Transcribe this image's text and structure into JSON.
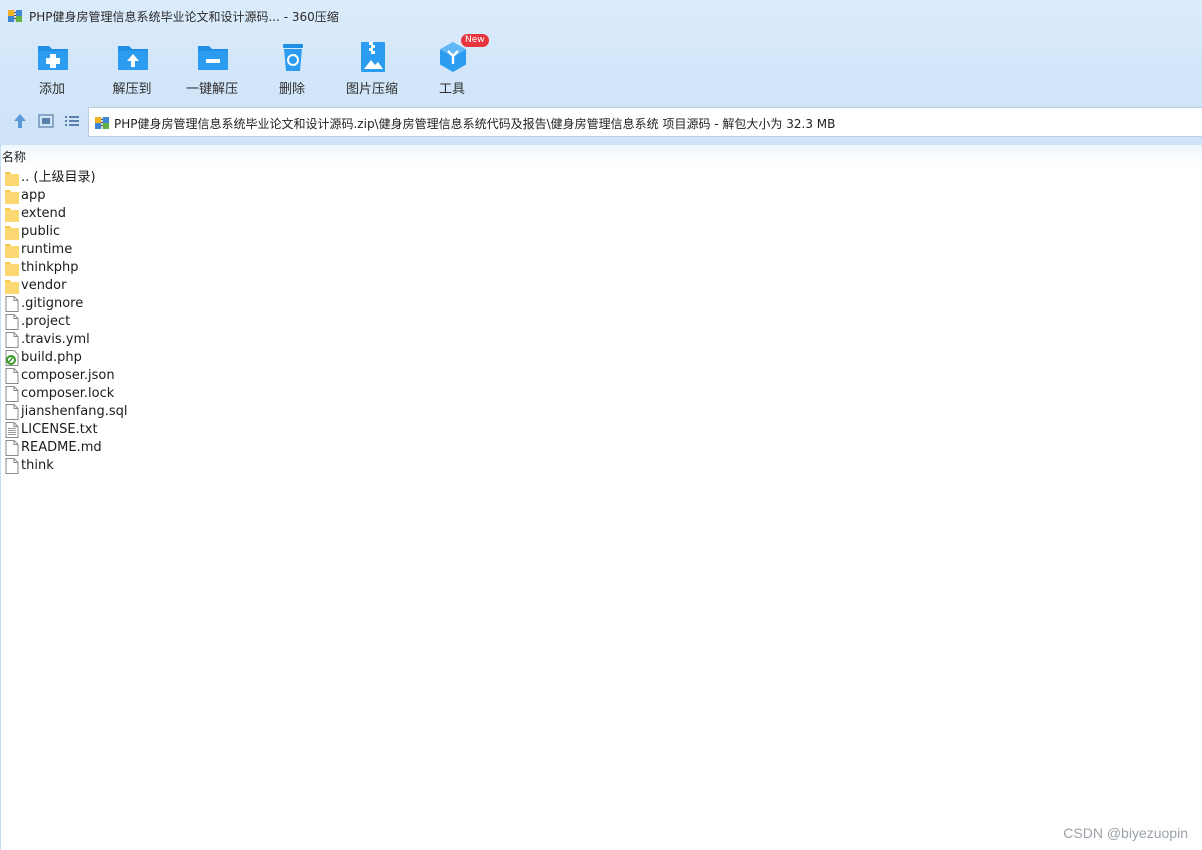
{
  "window": {
    "title": "PHP健身房管理信息系统毕业论文和设计源码... - 360压缩"
  },
  "toolbar": {
    "items": [
      {
        "label": "添加",
        "icon": "add-folder-icon"
      },
      {
        "label": "解压到",
        "icon": "extract-to-icon"
      },
      {
        "label": "一键解压",
        "icon": "one-click-extract-icon"
      },
      {
        "label": "删除",
        "icon": "recycle-bin-icon"
      },
      {
        "label": "图片压缩",
        "icon": "image-compress-icon"
      },
      {
        "label": "工具",
        "icon": "tools-cube-icon",
        "badge": "New"
      }
    ]
  },
  "nav": {
    "up_icon": "arrow-up-icon",
    "thumb_view_icon": "thumbnail-view-icon",
    "list_view_icon": "list-view-icon"
  },
  "address": {
    "path": "PHP健身房管理信息系统毕业论文和设计源码.zip\\健身房管理信息系统代码及报告\\健身房管理信息系统 项目源码 - 解包大小为 32.3 MB"
  },
  "list": {
    "column_name": "名称",
    "items": [
      {
        "name": ".. (上级目录)",
        "type": "folder"
      },
      {
        "name": "app",
        "type": "folder"
      },
      {
        "name": "extend",
        "type": "folder"
      },
      {
        "name": "public",
        "type": "folder"
      },
      {
        "name": "runtime",
        "type": "folder"
      },
      {
        "name": "thinkphp",
        "type": "folder"
      },
      {
        "name": "vendor",
        "type": "folder"
      },
      {
        "name": ".gitignore",
        "type": "file"
      },
      {
        "name": ".project",
        "type": "file"
      },
      {
        "name": ".travis.yml",
        "type": "file"
      },
      {
        "name": "build.php",
        "type": "php"
      },
      {
        "name": "composer.json",
        "type": "file"
      },
      {
        "name": "composer.lock",
        "type": "file"
      },
      {
        "name": "jianshenfang.sql",
        "type": "file"
      },
      {
        "name": "LICENSE.txt",
        "type": "text"
      },
      {
        "name": "README.md",
        "type": "file"
      },
      {
        "name": "think",
        "type": "file"
      }
    ]
  },
  "watermark": "CSDN @biyezuopin",
  "colors": {
    "accent": "#1a8fe3",
    "folder": "#fbd872",
    "badge": "#e8343c"
  }
}
